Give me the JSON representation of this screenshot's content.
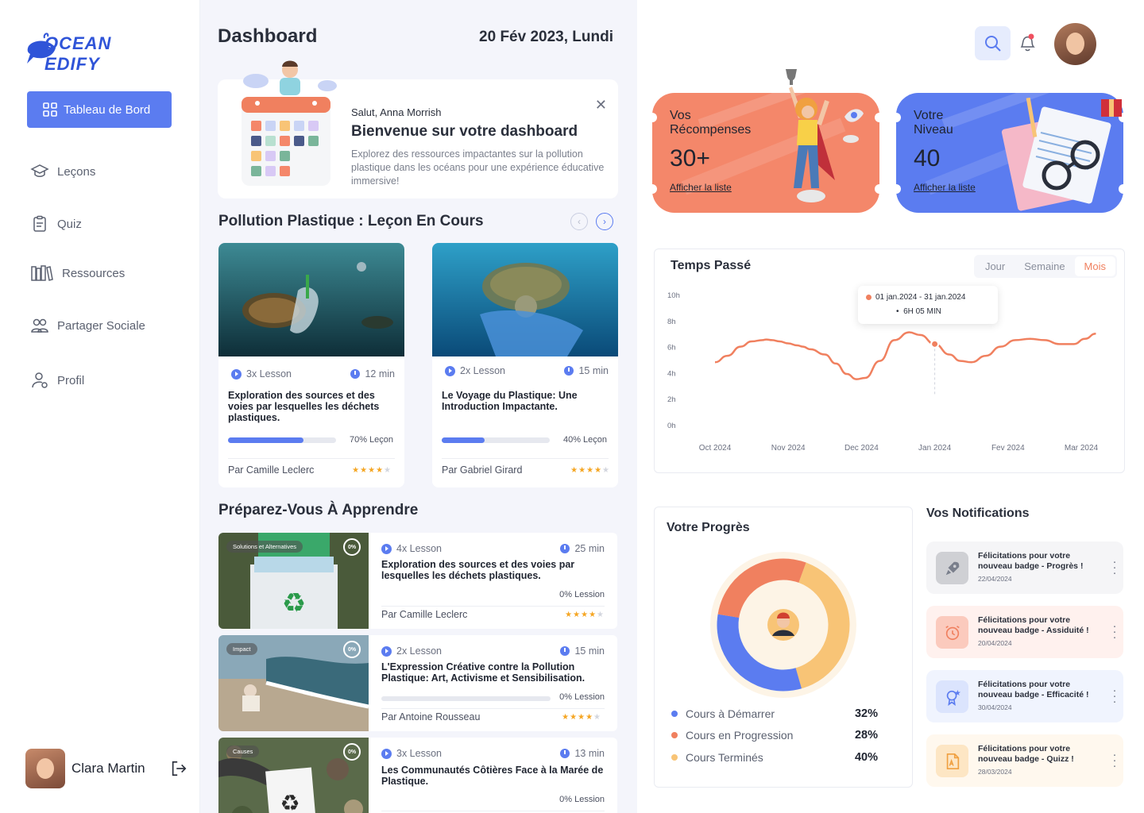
{
  "sidebar": {
    "logo_text": "OCEAN EDIFY",
    "nav": {
      "active": "Tableau de Bord",
      "items": [
        "Leçons",
        "Quiz",
        "Ressources",
        "Partager Sociale",
        "Profil"
      ]
    },
    "user_name": "Clara Martin"
  },
  "header": {
    "title": "Dashboard",
    "date": "20 Fév 2023, Lundi"
  },
  "welcome": {
    "greeting": "Salut, Anna Morrish",
    "title": "Bienvenue sur votre dashboard",
    "description": "Explorez des ressources impactantes sur la pollution plastique dans les océans pour une expérience éducative immersive!"
  },
  "current_lessons": {
    "title": "Pollution Plastique : Leçon En Cours",
    "cards": [
      {
        "lessons": "3x Lesson",
        "duration": "12 min",
        "title": "Exploration des sources et des voies par lesquelles les déchets plastiques.",
        "progress": 0.7,
        "progress_label": "70% Leçon",
        "author": "Par Camille Leclerc",
        "rating": 4
      },
      {
        "lessons": "2x Lesson",
        "duration": "15 min",
        "title": "Le Voyage du Plastique: Une Introduction Impactante.",
        "progress": 0.4,
        "progress_label": "40% Leçon",
        "author": "Par Gabriel Girard",
        "rating": 4
      }
    ]
  },
  "prepare": {
    "title": "Préparez-Vous À Apprendre",
    "items": [
      {
        "tag": "Solutions et Alternatives",
        "pct": "0%",
        "lessons": "4x Lesson",
        "duration": "25 min",
        "title": "Exploration des sources et des voies par lesquelles les déchets plastiques.",
        "progress_label": "0% Lession",
        "author": "Par Camille Leclerc",
        "rating": 4
      },
      {
        "tag": "Impact",
        "pct": "0%",
        "lessons": "2x Lesson",
        "duration": "15 min",
        "title": "L'Expression Créative contre la Pollution Plastique: Art, Activisme et Sensibilisation.",
        "progress_label": "0% Lession",
        "author": "Par Antoine Rousseau",
        "rating": 4
      },
      {
        "tag": "Causes",
        "pct": "0%",
        "lessons": "3x Lesson",
        "duration": "13 min",
        "title": "Les Communautés Côtières Face à la Marée de Plastique.",
        "progress_label": "0% Lession",
        "author": "",
        "rating": 0
      }
    ]
  },
  "rewards": {
    "label_line1": "Vos",
    "label_line2": "Récompenses",
    "value": "30+",
    "link": "Afficher la liste",
    "color": "#f4876a"
  },
  "level": {
    "label_line1": "Votre",
    "label_line2": "Niveau",
    "value": "40",
    "link": "Afficher la liste",
    "color": "#5b7cf0"
  },
  "time_chart": {
    "title": "Temps Passé",
    "tabs": [
      "Jour",
      "Semaine",
      "Mois"
    ],
    "active_tab": "Mois",
    "tooltip_range": "01 jan.2024 - 31 jan.2024",
    "tooltip_value": "6H 05 MIN"
  },
  "chart_data": {
    "type": "line",
    "x": [
      "Oct 2024",
      "Nov 2024",
      "Dec 2024",
      "Jan 2024",
      "Fev 2024",
      "Mar 2024"
    ],
    "y_ticks": [
      "10h",
      "8h",
      "6h",
      "4h",
      "2h",
      "0h"
    ],
    "ylim": [
      0,
      10
    ],
    "series": [
      {
        "x_pos": [
          0,
          0.17,
          0.35,
          0.5,
          0.65,
          0.7,
          0.78,
          0.88,
          1.0,
          1.12,
          1.2,
          1.3,
          1.5,
          1.65,
          1.8,
          1.93,
          2.05,
          2.25,
          2.45,
          2.65,
          2.8,
          3.0,
          3.2,
          3.35,
          3.5,
          3.7,
          3.9,
          4.1,
          4.3,
          4.5,
          4.7,
          4.9,
          5.05,
          5.2
        ],
        "values": [
          4.8,
          5.3,
          6.0,
          6.4,
          6.5,
          6.55,
          6.5,
          6.4,
          6.25,
          6.1,
          6.0,
          5.8,
          5.4,
          4.7,
          3.9,
          3.5,
          3.6,
          4.9,
          6.5,
          7.1,
          6.9,
          6.2,
          5.4,
          4.9,
          4.8,
          5.3,
          6.0,
          6.5,
          6.6,
          6.5,
          6.2,
          6.2,
          6.6,
          7.0
        ],
        "color": "#f0805f"
      }
    ],
    "highlight": {
      "x": 3.0,
      "y": 6.2
    }
  },
  "progress": {
    "title": "Votre Progrès",
    "legend": [
      {
        "label": "Cours à Démarrer",
        "value": "32%",
        "color": "#5b7cf0"
      },
      {
        "label": "Cours en Progression",
        "value": "28%",
        "color": "#f0805f"
      },
      {
        "label": "Cours Terminés",
        "value": "40%",
        "color": "#f8c476"
      }
    ]
  },
  "notifications": {
    "title": "Vos Notifications",
    "items": [
      {
        "line1": "Félicitations pour votre",
        "line2": "nouveau badge - Progrès !",
        "date": "22/04/2024",
        "icon": "rocket-icon",
        "bg": "#f5f5f7",
        "icon_bg": "#cfd0d4"
      },
      {
        "line1": "Félicitations pour votre",
        "line2": "nouveau badge - Assiduité !",
        "date": "20/04/2024",
        "icon": "alarm-clock-icon",
        "bg": "#fff1ee",
        "icon_bg": "#fbcabd"
      },
      {
        "line1": "Félicitations pour votre",
        "line2": "nouveau badge - Efficacité !",
        "date": "30/04/2024",
        "icon": "star-badge-icon",
        "bg": "#f0f4fe",
        "icon_bg": "#dbe4fd"
      },
      {
        "line1": "Félicitations pour votre",
        "line2": "nouveau badge - Quizz !",
        "date": "28/03/2024",
        "icon": "quiz-file-icon",
        "bg": "#fff8ee",
        "icon_bg": "#fde6c4"
      }
    ]
  }
}
